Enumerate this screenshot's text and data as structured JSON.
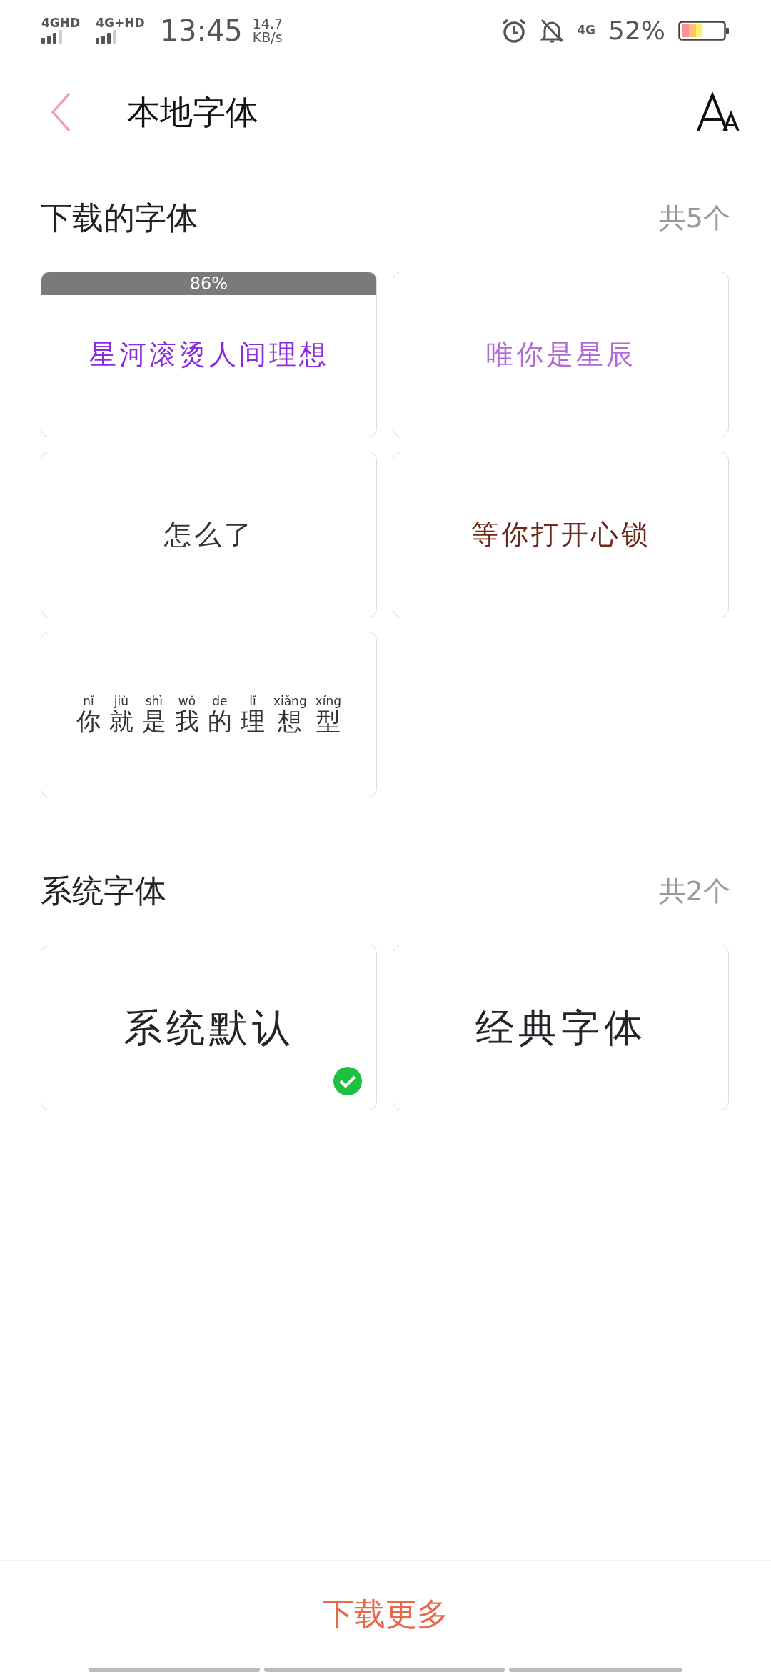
{
  "status_bar": {
    "sim_1": "4GHD",
    "sim_2": "4G+HD",
    "time": "13:45",
    "speed_value": "14.7",
    "speed_unit": "KB/s",
    "network": "4G",
    "battery": "52%"
  },
  "header": {
    "title": "本地字体"
  },
  "sections": [
    {
      "title": "下载的字体",
      "count": "共5个",
      "fonts": [
        {
          "kind": "plain",
          "sample": "星河滚烫人间理想",
          "color": "#8a2be2",
          "progress_label": "86%",
          "selected": false
        },
        {
          "kind": "plain",
          "sample": "唯你是星辰",
          "color": "#b36ad6",
          "selected": false
        },
        {
          "kind": "plain",
          "sample": "怎么了",
          "color": "#333333",
          "selected": false
        },
        {
          "kind": "plain",
          "sample": "等你打开心锁",
          "color": "#6b2a1a",
          "selected": false
        },
        {
          "kind": "ruby",
          "ruby": [
            {
              "char": "你",
              "pinyin": "nǐ"
            },
            {
              "char": "就",
              "pinyin": "jiù"
            },
            {
              "char": "是",
              "pinyin": "shì"
            },
            {
              "char": "我",
              "pinyin": "wǒ"
            },
            {
              "char": "的",
              "pinyin": "de"
            },
            {
              "char": "理",
              "pinyin": "lǐ"
            },
            {
              "char": "想",
              "pinyin": "xiǎng"
            },
            {
              "char": "型",
              "pinyin": "xíng"
            }
          ],
          "color": "#333333",
          "selected": false
        }
      ]
    },
    {
      "title": "系统字体",
      "count": "共2个",
      "fonts": [
        {
          "kind": "name",
          "sample": "系统默认",
          "selected": true
        },
        {
          "kind": "name",
          "sample": "经典字体",
          "selected": false
        }
      ]
    }
  ],
  "footer": {
    "button": "下载更多"
  }
}
